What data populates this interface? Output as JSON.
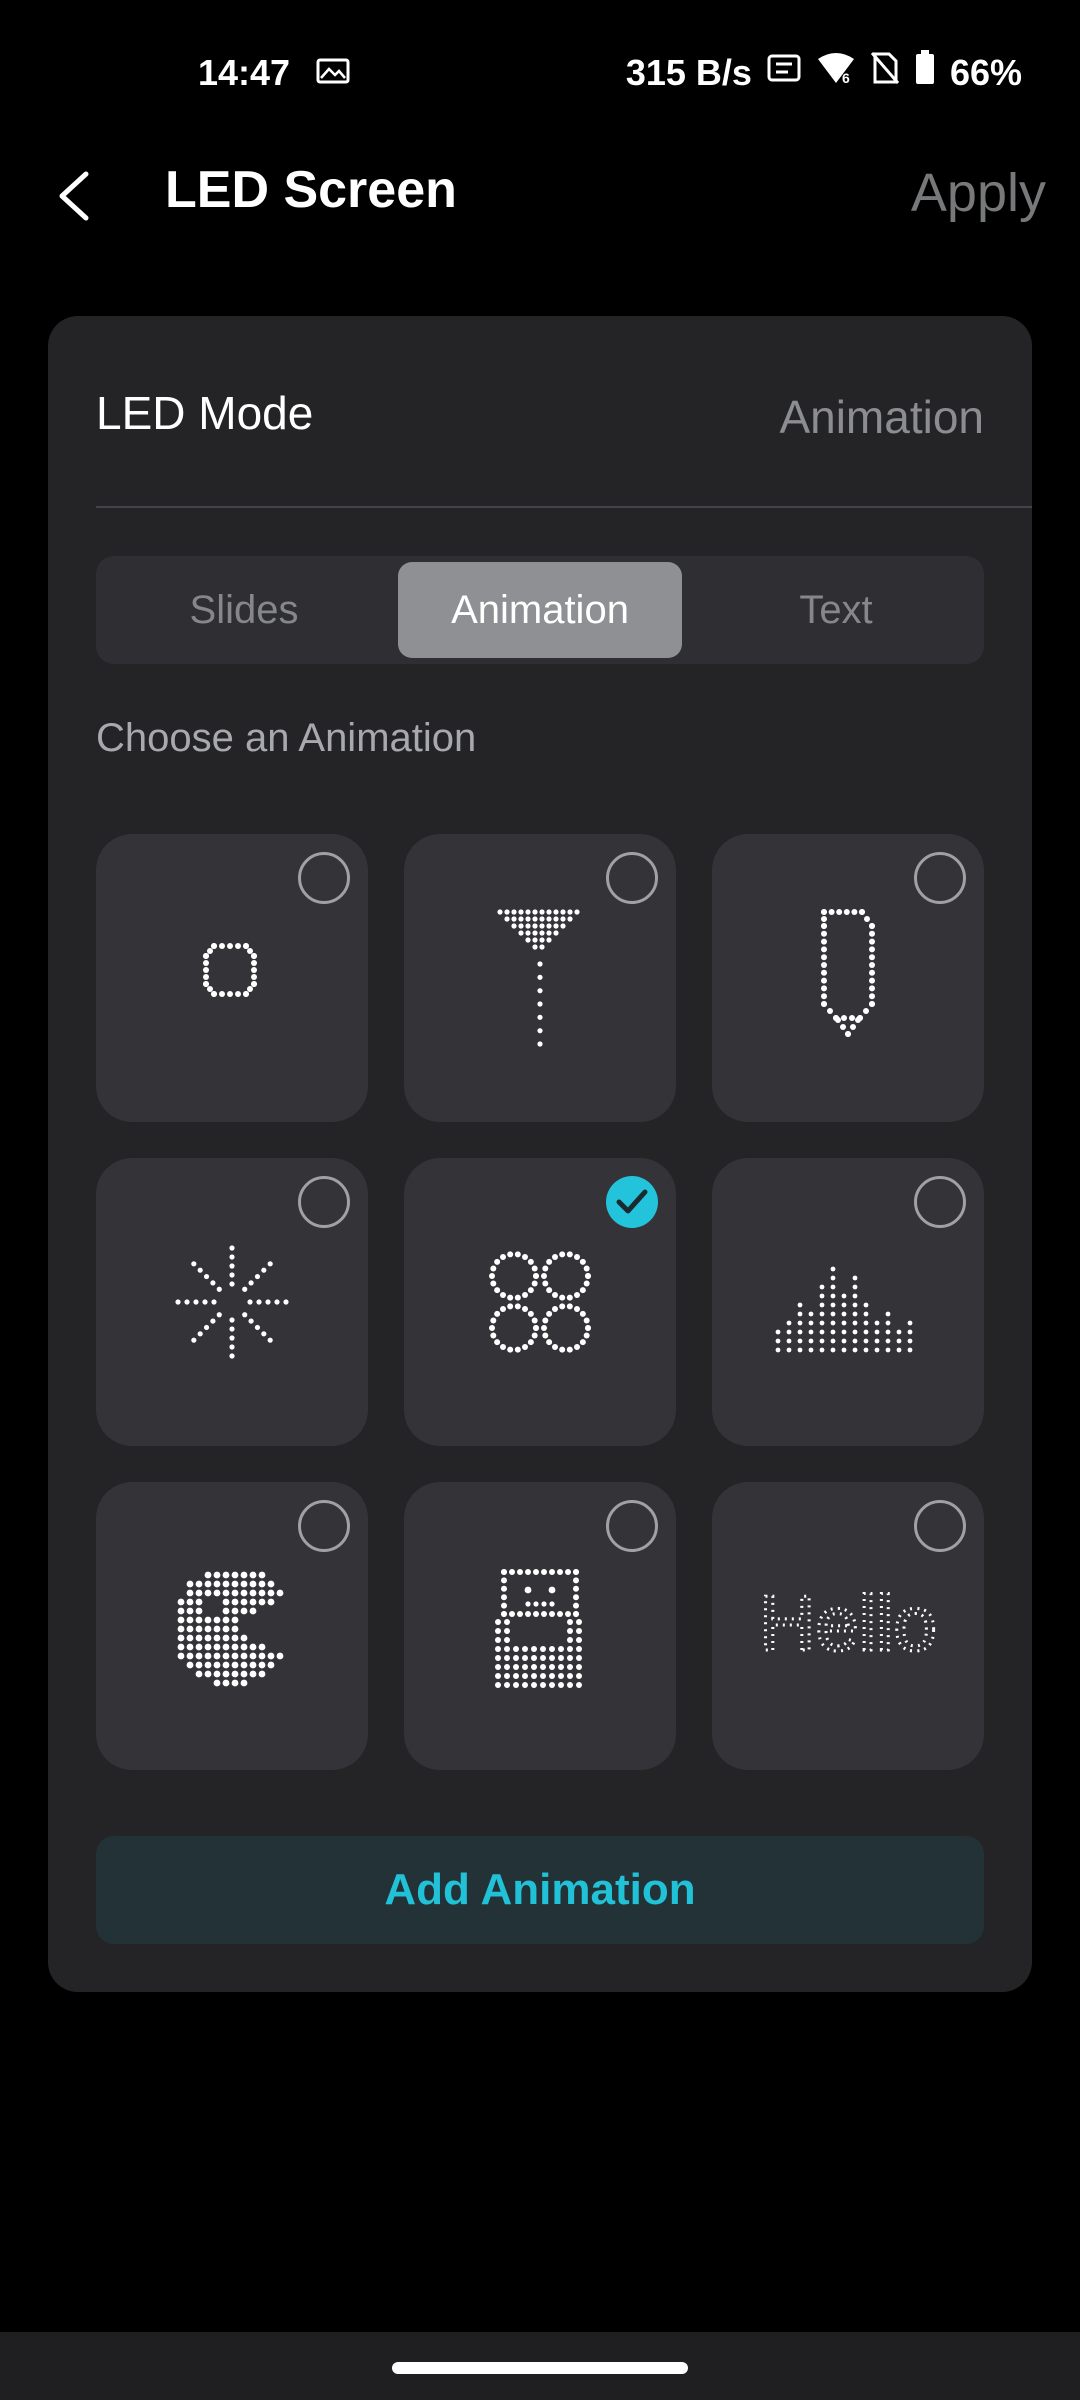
{
  "status_bar": {
    "time": "14:47",
    "net_speed": "315 B/s",
    "battery": "66%",
    "icons": [
      "image-icon",
      "refresh-rate-120hz-icon",
      "wifi-6-icon",
      "no-sim-icon",
      "battery-icon"
    ]
  },
  "header": {
    "title": "LED Screen",
    "apply_label": "Apply"
  },
  "led_mode": {
    "label": "LED Mode",
    "value": "Animation"
  },
  "tabs": [
    {
      "label": "Slides",
      "active": false
    },
    {
      "label": "Animation",
      "active": true
    },
    {
      "label": "Text",
      "active": false
    }
  ],
  "section_label": "Choose an Animation",
  "animations": [
    {
      "name": "ring-icon",
      "selected": false
    },
    {
      "name": "funnel-dots-icon",
      "selected": false
    },
    {
      "name": "balloon-icon",
      "selected": false
    },
    {
      "name": "firework-icon",
      "selected": false
    },
    {
      "name": "clover-icon",
      "selected": true
    },
    {
      "name": "equalizer-icon",
      "selected": false
    },
    {
      "name": "pacman-icon",
      "selected": false
    },
    {
      "name": "robot-icon",
      "selected": false
    },
    {
      "name": "hello-text-icon",
      "selected": false,
      "text": "Hello"
    }
  ],
  "add_button_label": "Add Animation",
  "colors": {
    "accent": "#24c3dc",
    "card": "#242427",
    "tile": "#333338",
    "background": "#000000"
  }
}
